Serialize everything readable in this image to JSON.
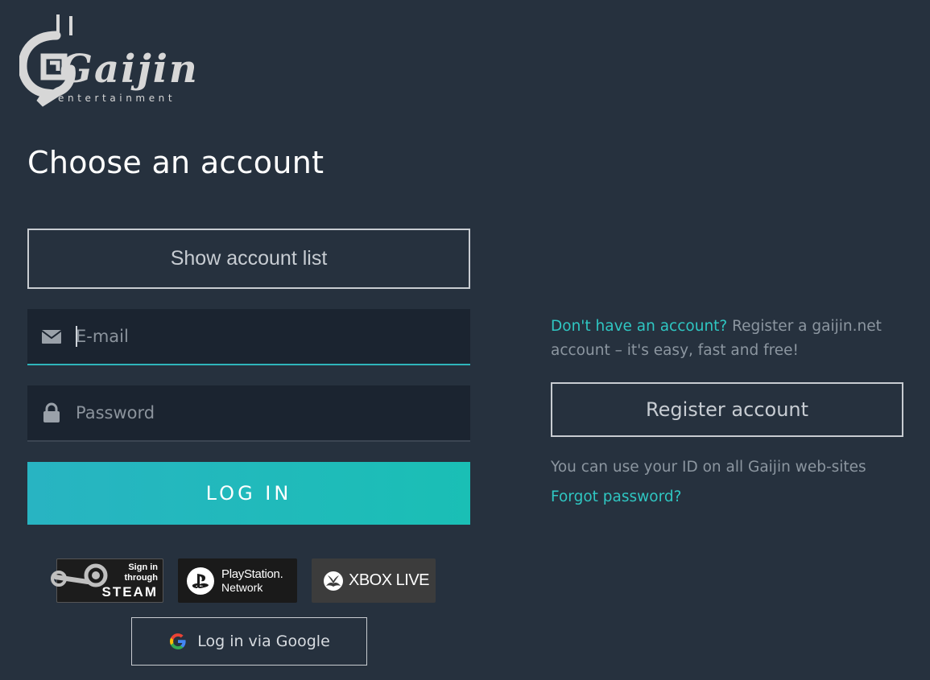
{
  "logo": {
    "word": "Gaijin",
    "subtitle": "entertainment",
    "icon": "snail-logo-icon"
  },
  "heading": "Choose an account",
  "show_account_list": "Show account list",
  "email": {
    "placeholder": "E-mail",
    "icon": "envelope-icon"
  },
  "password": {
    "placeholder": "Password",
    "icon": "lock-icon"
  },
  "login_button": "LOG IN",
  "social": {
    "steam": {
      "line1": "Sign in",
      "line2": "through",
      "line3": "STEAM",
      "icon": "steam-icon"
    },
    "psn": {
      "line1": "PlayStation.",
      "line2": "Network",
      "icon": "playstation-icon"
    },
    "xbox": {
      "label": "XBOX LIVE",
      "icon": "xbox-icon"
    },
    "google": {
      "label": "Log in via Google",
      "icon": "google-icon"
    }
  },
  "register": {
    "prompt_link": "Don't have an account?",
    "prompt_text": " Register a gaijin.net account – it's easy, fast and free!",
    "button": "Register account",
    "note": "You can use your ID on all Gaijin web-sites",
    "forgot": "Forgot password?"
  },
  "colors": {
    "background": "#26313e",
    "field": "#1b2430",
    "accent": "#2fc6c2",
    "login_gradient_start": "#28b4c2",
    "login_gradient_end": "#1abfb5"
  }
}
